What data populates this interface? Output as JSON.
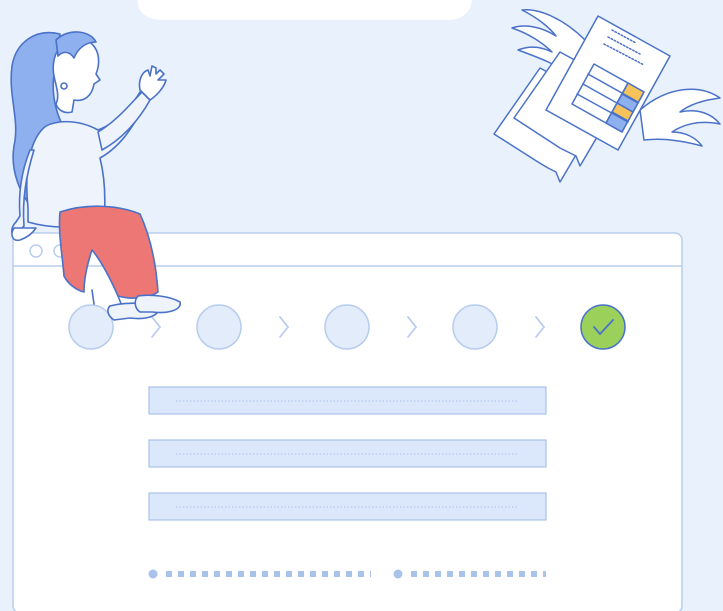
{
  "illustration": {
    "palette": {
      "background": "#e9f1fd",
      "outline": "#4a72c8",
      "panel": "#ffffff",
      "panel_border": "#b8cdee",
      "step_fill": "#e3ecfb",
      "field_fill": "#dbe7fa",
      "success": "#9bd15a",
      "skirt": "#ec7774",
      "hair": "#8fb0ee",
      "accent_yellow": "#f6c35b"
    },
    "wizard": {
      "steps": [
        {
          "state": "incomplete"
        },
        {
          "state": "incomplete"
        },
        {
          "state": "incomplete"
        },
        {
          "state": "incomplete"
        },
        {
          "state": "complete",
          "icon": "check-icon"
        }
      ],
      "form_field_count": 3,
      "pagination": {
        "groups": 2
      }
    },
    "decorations": [
      "speech-bubble",
      "woman-sitting",
      "flying-documents"
    ]
  }
}
